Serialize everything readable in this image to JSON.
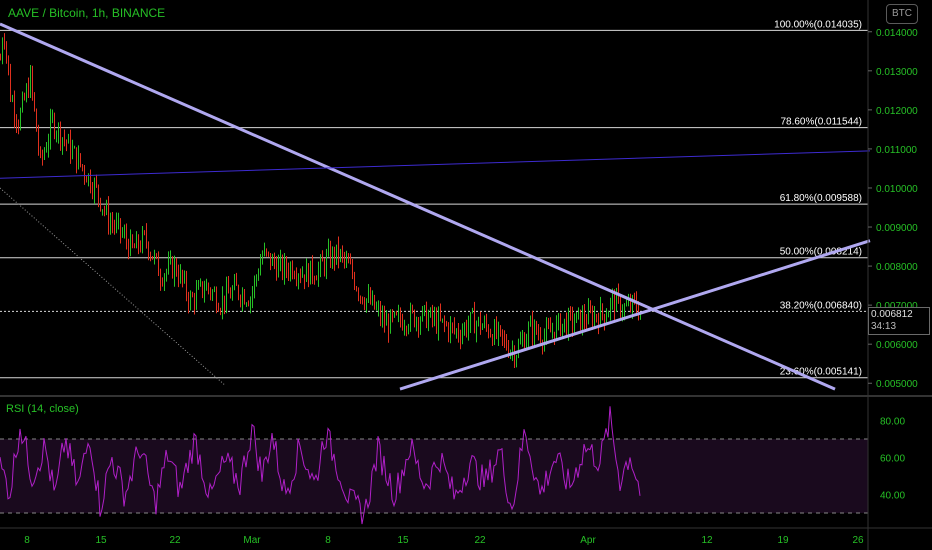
{
  "header": {
    "symbol": "AAVE / Bitcoin, 1h, BINANCE",
    "currency_badge": "BTC"
  },
  "colors": {
    "background": "#000000",
    "candle_up": "#26c026",
    "candle_down": "#e0301e",
    "trendline": "#b0a8f0",
    "level_line": "#d8d8d8",
    "dark_trendline": "#3d2bd0",
    "rsi_line": "#b020c8",
    "rsi_band_fill": "#1a0a1e",
    "axis_text": "#26c026",
    "fib_text": "#ffffff"
  },
  "price_tag": {
    "price": "0.006812",
    "countdown": "34:13"
  },
  "rsi": {
    "title": "RSI (14, close)",
    "upper_band": 70,
    "lower_band": 30
  },
  "chart_data": {
    "type": "candlestick",
    "price_axis": {
      "ticks": [
        "0.014000",
        "0.013000",
        "0.012000",
        "0.011000",
        "0.010000",
        "0.009000",
        "0.008000",
        "0.007000",
        "0.006000",
        "0.005000"
      ],
      "ylim": [
        0.00475,
        0.01425
      ]
    },
    "rsi_axis": {
      "ticks": [
        "80.00",
        "60.00",
        "40.00"
      ],
      "ylim": [
        23,
        90
      ]
    },
    "time_axis": {
      "ticks": [
        "8",
        "15",
        "22",
        "Mar",
        "8",
        "15",
        "22",
        "Apr",
        "12",
        "19",
        "26"
      ]
    },
    "fib_levels": [
      {
        "label": "100.00%(0.014035)",
        "value": 0.014035
      },
      {
        "label": "78.60%(0.011544)",
        "value": 0.011544
      },
      {
        "label": "61.80%(0.009588)",
        "value": 0.009588
      },
      {
        "label": "50.00%(0.008214)",
        "value": 0.008214
      },
      {
        "label": "38.20%(0.006840)",
        "value": 0.00684
      },
      {
        "label": "23.60%(0.005141)",
        "value": 0.005141
      }
    ],
    "price_path": [
      [
        0,
        0.0133
      ],
      [
        3,
        0.0142
      ],
      [
        10,
        0.0124
      ],
      [
        18,
        0.0117
      ],
      [
        30,
        0.0128
      ],
      [
        40,
        0.0106
      ],
      [
        52,
        0.0117
      ],
      [
        65,
        0.0112
      ],
      [
        80,
        0.0106
      ],
      [
        95,
        0.01
      ],
      [
        108,
        0.0092
      ],
      [
        122,
        0.0088
      ],
      [
        132,
        0.0084
      ],
      [
        145,
        0.0087
      ],
      [
        160,
        0.0078
      ],
      [
        175,
        0.008
      ],
      [
        190,
        0.0071
      ],
      [
        205,
        0.0075
      ],
      [
        220,
        0.0071
      ],
      [
        235,
        0.0074
      ],
      [
        250,
        0.0072
      ],
      [
        262,
        0.0083
      ],
      [
        272,
        0.0081
      ],
      [
        282,
        0.0079
      ],
      [
        292,
        0.008
      ],
      [
        305,
        0.0078
      ],
      [
        318,
        0.0079
      ],
      [
        328,
        0.0082
      ],
      [
        338,
        0.0083
      ],
      [
        350,
        0.0079
      ],
      [
        360,
        0.0073
      ],
      [
        372,
        0.007
      ],
      [
        385,
        0.0065
      ],
      [
        398,
        0.0066
      ],
      [
        412,
        0.0067
      ],
      [
        426,
        0.0067
      ],
      [
        442,
        0.0065
      ],
      [
        458,
        0.0063
      ],
      [
        472,
        0.0066
      ],
      [
        488,
        0.0064
      ],
      [
        505,
        0.006
      ],
      [
        515,
        0.0058
      ],
      [
        530,
        0.0064
      ],
      [
        545,
        0.0062
      ],
      [
        560,
        0.0065
      ],
      [
        575,
        0.0066
      ],
      [
        590,
        0.0067
      ],
      [
        605,
        0.0068
      ],
      [
        612,
        0.0071
      ],
      [
        625,
        0.0069
      ],
      [
        635,
        0.007
      ],
      [
        640,
        0.00681
      ]
    ],
    "rsi_path": [
      [
        0,
        55
      ],
      [
        10,
        42
      ],
      [
        20,
        78
      ],
      [
        32,
        50
      ],
      [
        45,
        66
      ],
      [
        55,
        38
      ],
      [
        65,
        70
      ],
      [
        78,
        44
      ],
      [
        90,
        72
      ],
      [
        100,
        34
      ],
      [
        112,
        60
      ],
      [
        125,
        40
      ],
      [
        140,
        66
      ],
      [
        155,
        35
      ],
      [
        168,
        62
      ],
      [
        180,
        42
      ],
      [
        195,
        70
      ],
      [
        210,
        38
      ],
      [
        225,
        58
      ],
      [
        240,
        46
      ],
      [
        252,
        76
      ],
      [
        262,
        50
      ],
      [
        272,
        72
      ],
      [
        285,
        40
      ],
      [
        300,
        66
      ],
      [
        315,
        45
      ],
      [
        325,
        74
      ],
      [
        338,
        55
      ],
      [
        350,
        36
      ],
      [
        365,
        30
      ],
      [
        378,
        64
      ],
      [
        395,
        40
      ],
      [
        410,
        66
      ],
      [
        425,
        45
      ],
      [
        440,
        60
      ],
      [
        455,
        38
      ],
      [
        470,
        58
      ],
      [
        485,
        46
      ],
      [
        500,
        64
      ],
      [
        512,
        32
      ],
      [
        525,
        75
      ],
      [
        540,
        40
      ],
      [
        555,
        60
      ],
      [
        570,
        44
      ],
      [
        585,
        66
      ],
      [
        600,
        58
      ],
      [
        610,
        80
      ],
      [
        620,
        48
      ],
      [
        630,
        62
      ],
      [
        640,
        42
      ]
    ],
    "trendlines": [
      {
        "name": "descending",
        "from": [
          0,
          0.0142
        ],
        "to": [
          835,
          0.00485
        ]
      },
      {
        "name": "ascending",
        "from": [
          400,
          0.00485
        ],
        "to": [
          870,
          0.00865
        ]
      },
      {
        "name": "dark",
        "from": [
          0,
          0.01025
        ],
        "to": [
          870,
          0.01095
        ]
      },
      {
        "name": "dotted",
        "from": [
          0,
          0.01
        ],
        "to": [
          225,
          0.00495
        ]
      }
    ],
    "grid": false
  }
}
